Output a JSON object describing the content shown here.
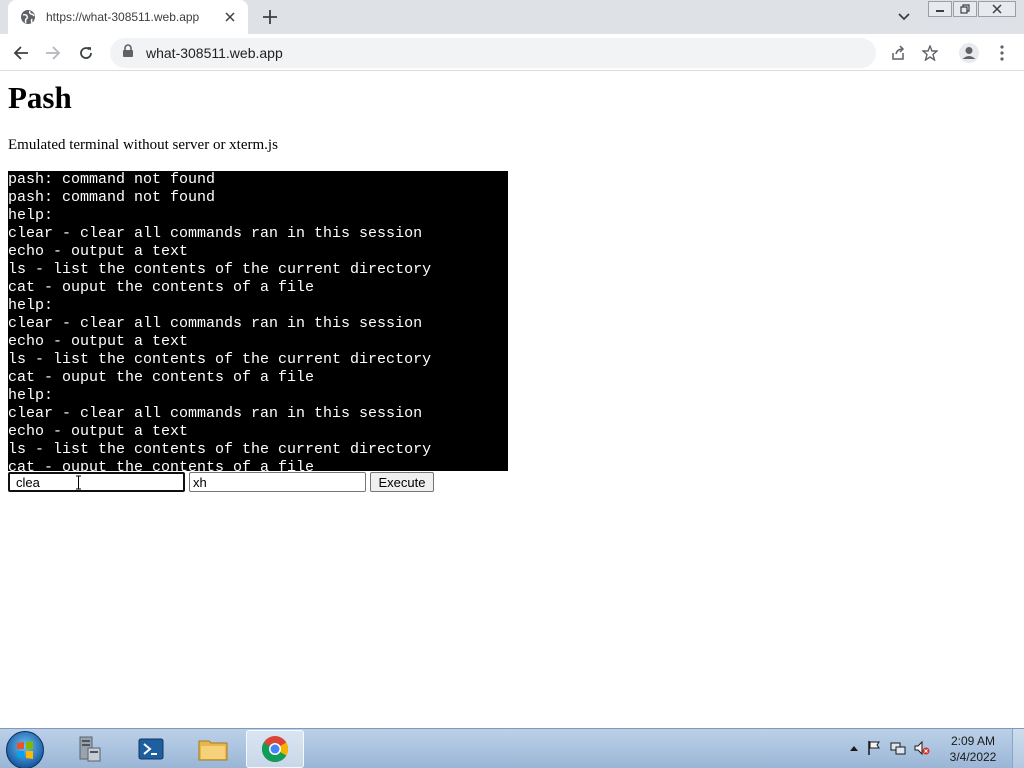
{
  "browser": {
    "tab_title": "https://what-308511.web.app",
    "url": "what-308511.web.app"
  },
  "page": {
    "title": "Pash",
    "subtitle": "Emulated terminal without server or xterm.js"
  },
  "terminal": {
    "lines": [
      "pash: command not found",
      "pash: command not found",
      "help:",
      "clear - clear all commands ran in this session",
      "echo - output a text",
      "ls - list the contents of the current directory",
      "cat - ouput the contents of a file",
      "help:",
      "clear - clear all commands ran in this session",
      "echo - output a text",
      "ls - list the contents of the current directory",
      "cat - ouput the contents of a file",
      "help:",
      "clear - clear all commands ran in this session",
      "echo - output a text",
      "ls - list the contents of the current directory",
      "cat - ouput the contents of a file"
    ]
  },
  "form": {
    "command_value": "clea",
    "argument_value": "xh",
    "execute_label": "Execute"
  },
  "taskbar": {
    "time": "2:09 AM",
    "date": "3/4/2022"
  }
}
